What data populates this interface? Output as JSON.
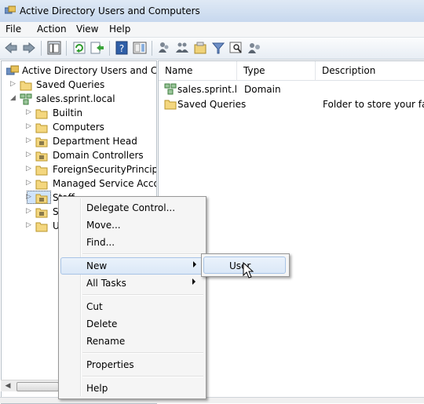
{
  "window": {
    "title": "Active Directory Users and Computers"
  },
  "menubar": {
    "items": [
      "File",
      "Action",
      "View",
      "Help"
    ]
  },
  "toolbar": {
    "icons": [
      "back-icon",
      "forward-icon",
      "console-tree-icon",
      "refresh-icon",
      "export-list-icon",
      "help-icon",
      "show-action-pane-icon",
      "users-icon",
      "group-icon",
      "ou-icon",
      "filter-icon",
      "find-icon",
      "add-to-group-icon"
    ]
  },
  "tree": {
    "root": "Active Directory Users and Com",
    "items": [
      {
        "label": "Saved Queries",
        "level": 1,
        "expander": "collapsed"
      },
      {
        "label": "sales.sprint.local",
        "level": 1,
        "expander": "expanded"
      },
      {
        "label": "Builtin",
        "level": 2,
        "expander": "collapsed"
      },
      {
        "label": "Computers",
        "level": 2,
        "expander": "collapsed"
      },
      {
        "label": "Department Head",
        "level": 2,
        "expander": "collapsed"
      },
      {
        "label": "Domain Controllers",
        "level": 2,
        "expander": "collapsed"
      },
      {
        "label": "ForeignSecurityPrincipals",
        "level": 2,
        "expander": "collapsed"
      },
      {
        "label": "Managed Service Accour",
        "level": 2,
        "expander": "collapsed"
      },
      {
        "label": "Staff",
        "level": 2,
        "expander": "collapsed"
      },
      {
        "label": "Sy",
        "level": 2,
        "expander": "collapsed"
      },
      {
        "label": "U",
        "level": 2,
        "expander": "collapsed"
      }
    ]
  },
  "list": {
    "columns": [
      "Name",
      "Type",
      "Description"
    ],
    "rows": [
      {
        "name": "sales.sprint.l...",
        "type": "Domain",
        "description": ""
      },
      {
        "name": "Saved Queries",
        "type": "",
        "description": "Folder to store your favo"
      }
    ]
  },
  "context_menu": {
    "items": [
      "Delegate Control...",
      "Move...",
      "Find...",
      "New",
      "All Tasks",
      "Cut",
      "Delete",
      "Rename",
      "Properties",
      "Help"
    ],
    "highlighted": "New"
  },
  "submenu": {
    "items": [
      "User"
    ]
  },
  "statusbar": {
    "text": ""
  }
}
